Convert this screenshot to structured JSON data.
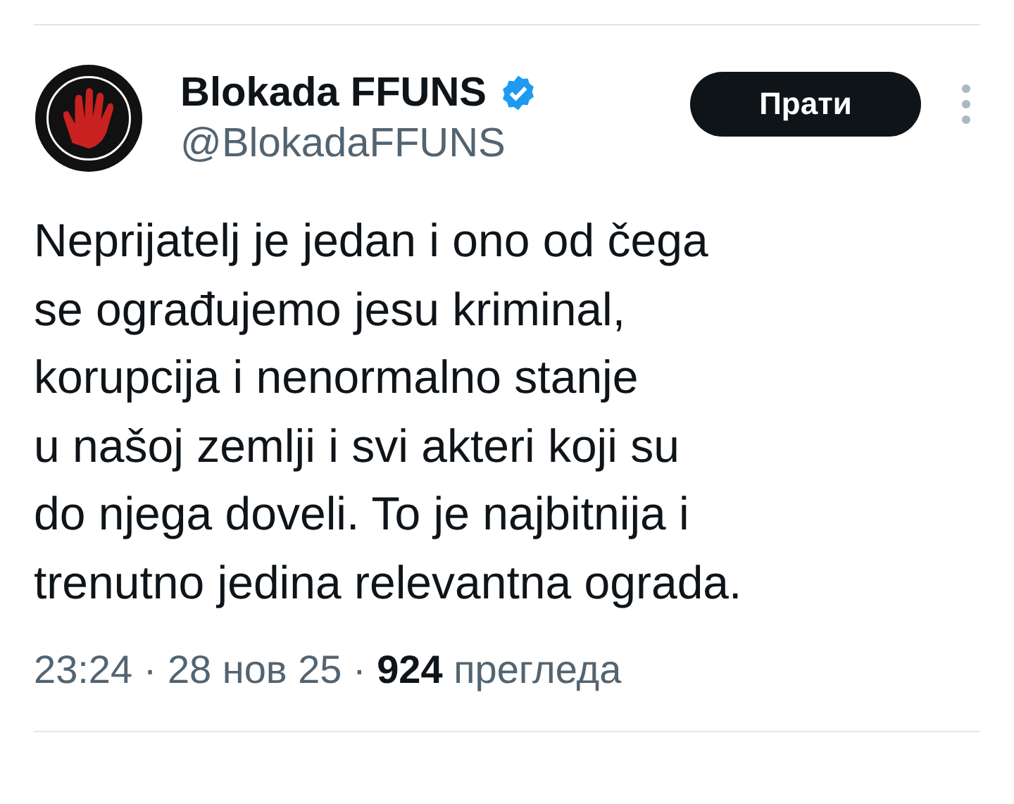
{
  "author": {
    "name": "Blokada FFUNS",
    "verified": true,
    "handle": "@BlokadaFFUNS"
  },
  "follow_button": "Прати",
  "text_lines": [
    "Neprijatelj je jedan i ono od čega",
    "se ograđujemo jesu kriminal,",
    "korupcija i nenormalno stanje",
    "u našoj zemlji i svi akteri koji su",
    "do njega doveli. To je najbitnija i",
    "trenutno jedina relevantna ograda."
  ],
  "meta": "23:24 · 28 нов 25 · **924** прегледа"
}
